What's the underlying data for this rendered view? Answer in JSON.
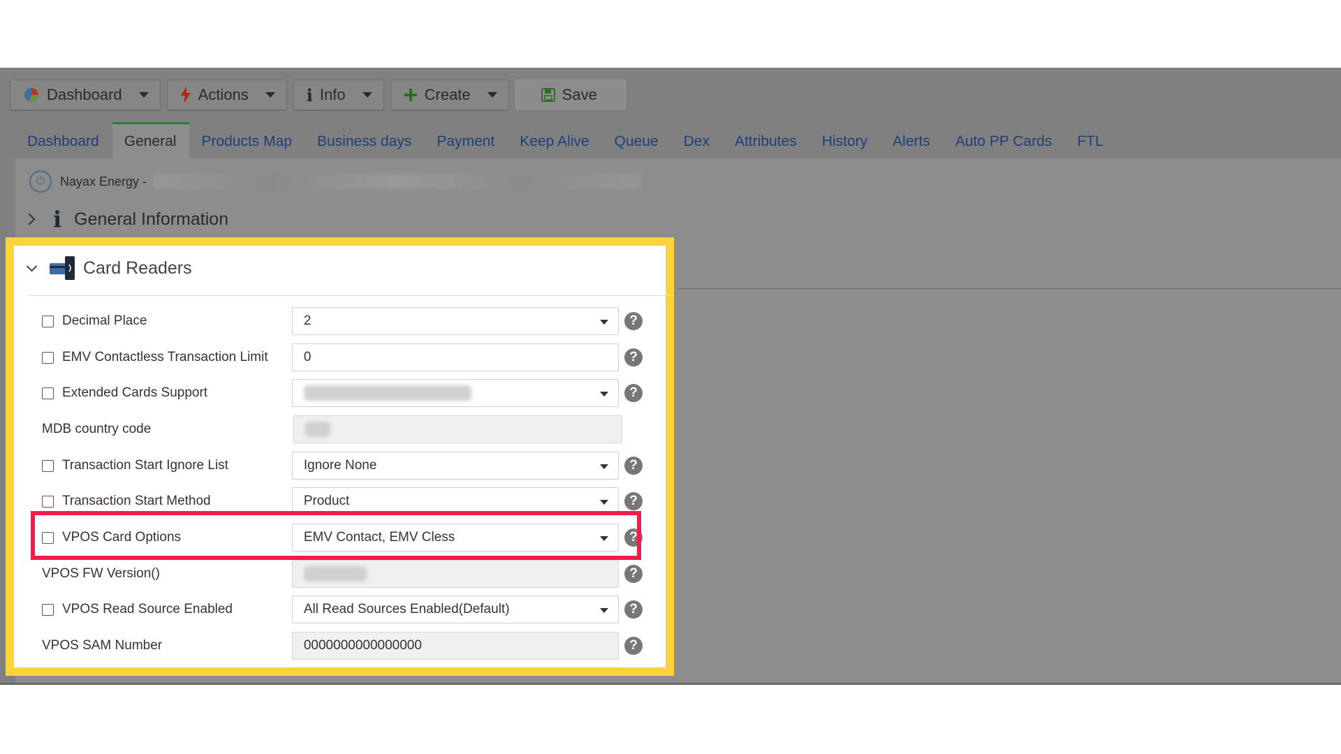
{
  "toolbar": {
    "dashboard": "Dashboard",
    "actions": "Actions",
    "info": "Info",
    "create": "Create",
    "save": "Save"
  },
  "tabs": [
    "Dashboard",
    "General",
    "Products Map",
    "Business days",
    "Payment",
    "Keep Alive",
    "Queue",
    "Dex",
    "Attributes",
    "History",
    "Alerts",
    "Auto PP Cards",
    "FTL"
  ],
  "active_tab": "General",
  "breadcrumb": {
    "prefix": "Nayax Energy -"
  },
  "sections": {
    "general_information": "General Information",
    "card_readers": "Card Readers"
  },
  "fields": [
    {
      "label": "Decimal Place",
      "value": "2"
    },
    {
      "label": "EMV Contactless Transaction Limit",
      "value": "0"
    },
    {
      "label": "Extended Cards Support",
      "value": ""
    },
    {
      "label": "MDB country code",
      "value": ""
    },
    {
      "label": "Transaction Start Ignore List",
      "value": "Ignore None"
    },
    {
      "label": "Transaction Start Method",
      "value": "Product"
    },
    {
      "label": "VPOS Card Options",
      "value": "EMV Contact, EMV Cless"
    },
    {
      "label": "VPOS FW Version()",
      "value": ""
    },
    {
      "label": "VPOS Read Source Enabled",
      "value": "All Read Sources Enabled(Default)"
    },
    {
      "label": "VPOS SAM Number",
      "value": "0000000000000000"
    }
  ],
  "help_glyph": "?",
  "colors": {
    "panel_highlight": "#fbd33c",
    "row_highlight": "#ee1e4b",
    "active_tab_border": "#2e7d32",
    "link": "#1f3f7a"
  }
}
